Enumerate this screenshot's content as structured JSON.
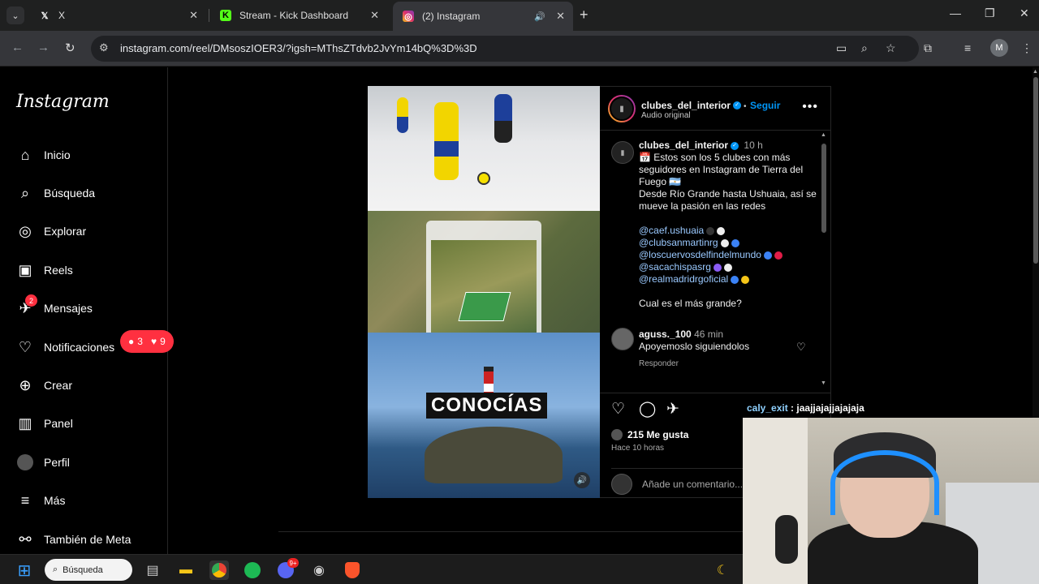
{
  "browser": {
    "tabs": [
      {
        "title": "X",
        "favicon": "x-logo-icon"
      },
      {
        "title": "Stream - Kick Dashboard",
        "favicon": "kick-logo-icon"
      },
      {
        "title": "(2) Instagram",
        "favicon": "instagram-logo-icon",
        "active": true
      }
    ],
    "url": "instagram.com/reel/DMsoszIOER3/?igsh=MThsZTdvb2JvYm14bQ%3D%3D",
    "profile_initial": "M"
  },
  "sidebar": {
    "logo": "Instagram",
    "items": [
      {
        "label": "Inicio",
        "icon": "home-icon"
      },
      {
        "label": "Búsqueda",
        "icon": "search-icon"
      },
      {
        "label": "Explorar",
        "icon": "compass-icon"
      },
      {
        "label": "Reels",
        "icon": "reels-icon"
      },
      {
        "label": "Mensajes",
        "icon": "messenger-icon",
        "badge": "2"
      },
      {
        "label": "Notificaciones",
        "icon": "heart-icon"
      },
      {
        "label": "Crear",
        "icon": "plus-square-icon"
      },
      {
        "label": "Panel",
        "icon": "chart-icon"
      },
      {
        "label": "Perfil",
        "icon": "profile-avatar-icon"
      },
      {
        "label": "Más",
        "icon": "menu-icon"
      },
      {
        "label": "También de Meta",
        "icon": "meta-apps-icon"
      }
    ],
    "notif_pill": {
      "comments": "3",
      "likes": "9"
    }
  },
  "reel": {
    "overlay_text": "CONOCÍAS"
  },
  "post": {
    "author": "clubes_del_interior",
    "follow_label": "Seguir",
    "audio": "Audio original",
    "caption_time": "10 h",
    "caption_lines": [
      "Estos son los 5 clubes con más seguidores en Instagram de Tierra del Fuego",
      "Desde Río Grande hasta Ushuaia, así se mueve la pasión en las redes"
    ],
    "mentions": [
      "@caef.ushuaia",
      "@clubsanmartinrg",
      "@loscuervosdelfindelmundo",
      "@sacachispasrg",
      "@realmadridrgoficial"
    ],
    "question": "Cual es el más grande?",
    "comment": {
      "user": "aguss._100",
      "time": "46 min",
      "text": "Apoyemoslo siguiendolos",
      "reply_label": "Responder"
    },
    "likes": "215 Me gusta",
    "posted": "Hace 10 horas",
    "add_comment_placeholder": "Añade un comentario..."
  },
  "stream_chat": {
    "user": "caly_exit",
    "message": "jaajjajajjajajaja"
  },
  "taskbar": {
    "search_label": "Búsqueda",
    "discord_badge": "9+"
  }
}
